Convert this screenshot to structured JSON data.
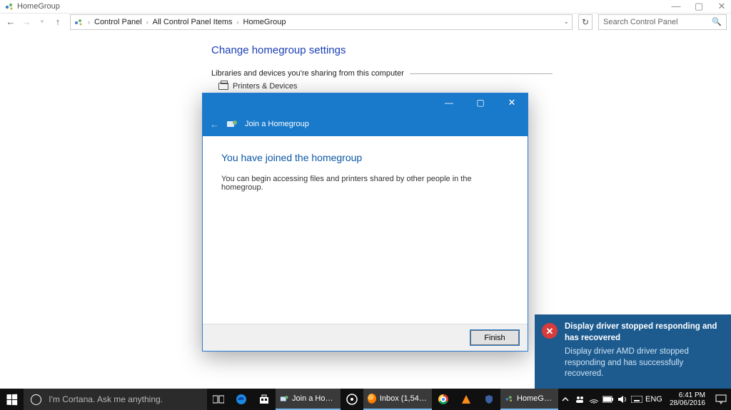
{
  "window": {
    "title": "HomeGroup",
    "breadcrumbs": [
      "Control Panel",
      "All Control Panel Items",
      "HomeGroup"
    ],
    "search_placeholder": "Search Control Panel"
  },
  "page": {
    "heading": "Change homegroup settings",
    "section_label": "Libraries and devices you're sharing from this computer",
    "shared_item": "Printers & Devices"
  },
  "wizard": {
    "title": "Join a Homegroup",
    "heading": "You have joined the homegroup",
    "body": "You can begin accessing files and printers shared by other people in the homegroup.",
    "finish": "Finish"
  },
  "toast": {
    "title": "Display driver stopped responding and has recovered",
    "body": "Display driver AMD driver stopped responding and has successfully recovered."
  },
  "taskbar": {
    "cortana_placeholder": "I'm Cortana. Ask me anything.",
    "items": {
      "join": "Join a Home...",
      "inbox": "Inbox (1,548) ...",
      "homegroup": "HomeGroup"
    },
    "lang": "ENG",
    "time": "6:41 PM",
    "date": "28/06/2016"
  }
}
